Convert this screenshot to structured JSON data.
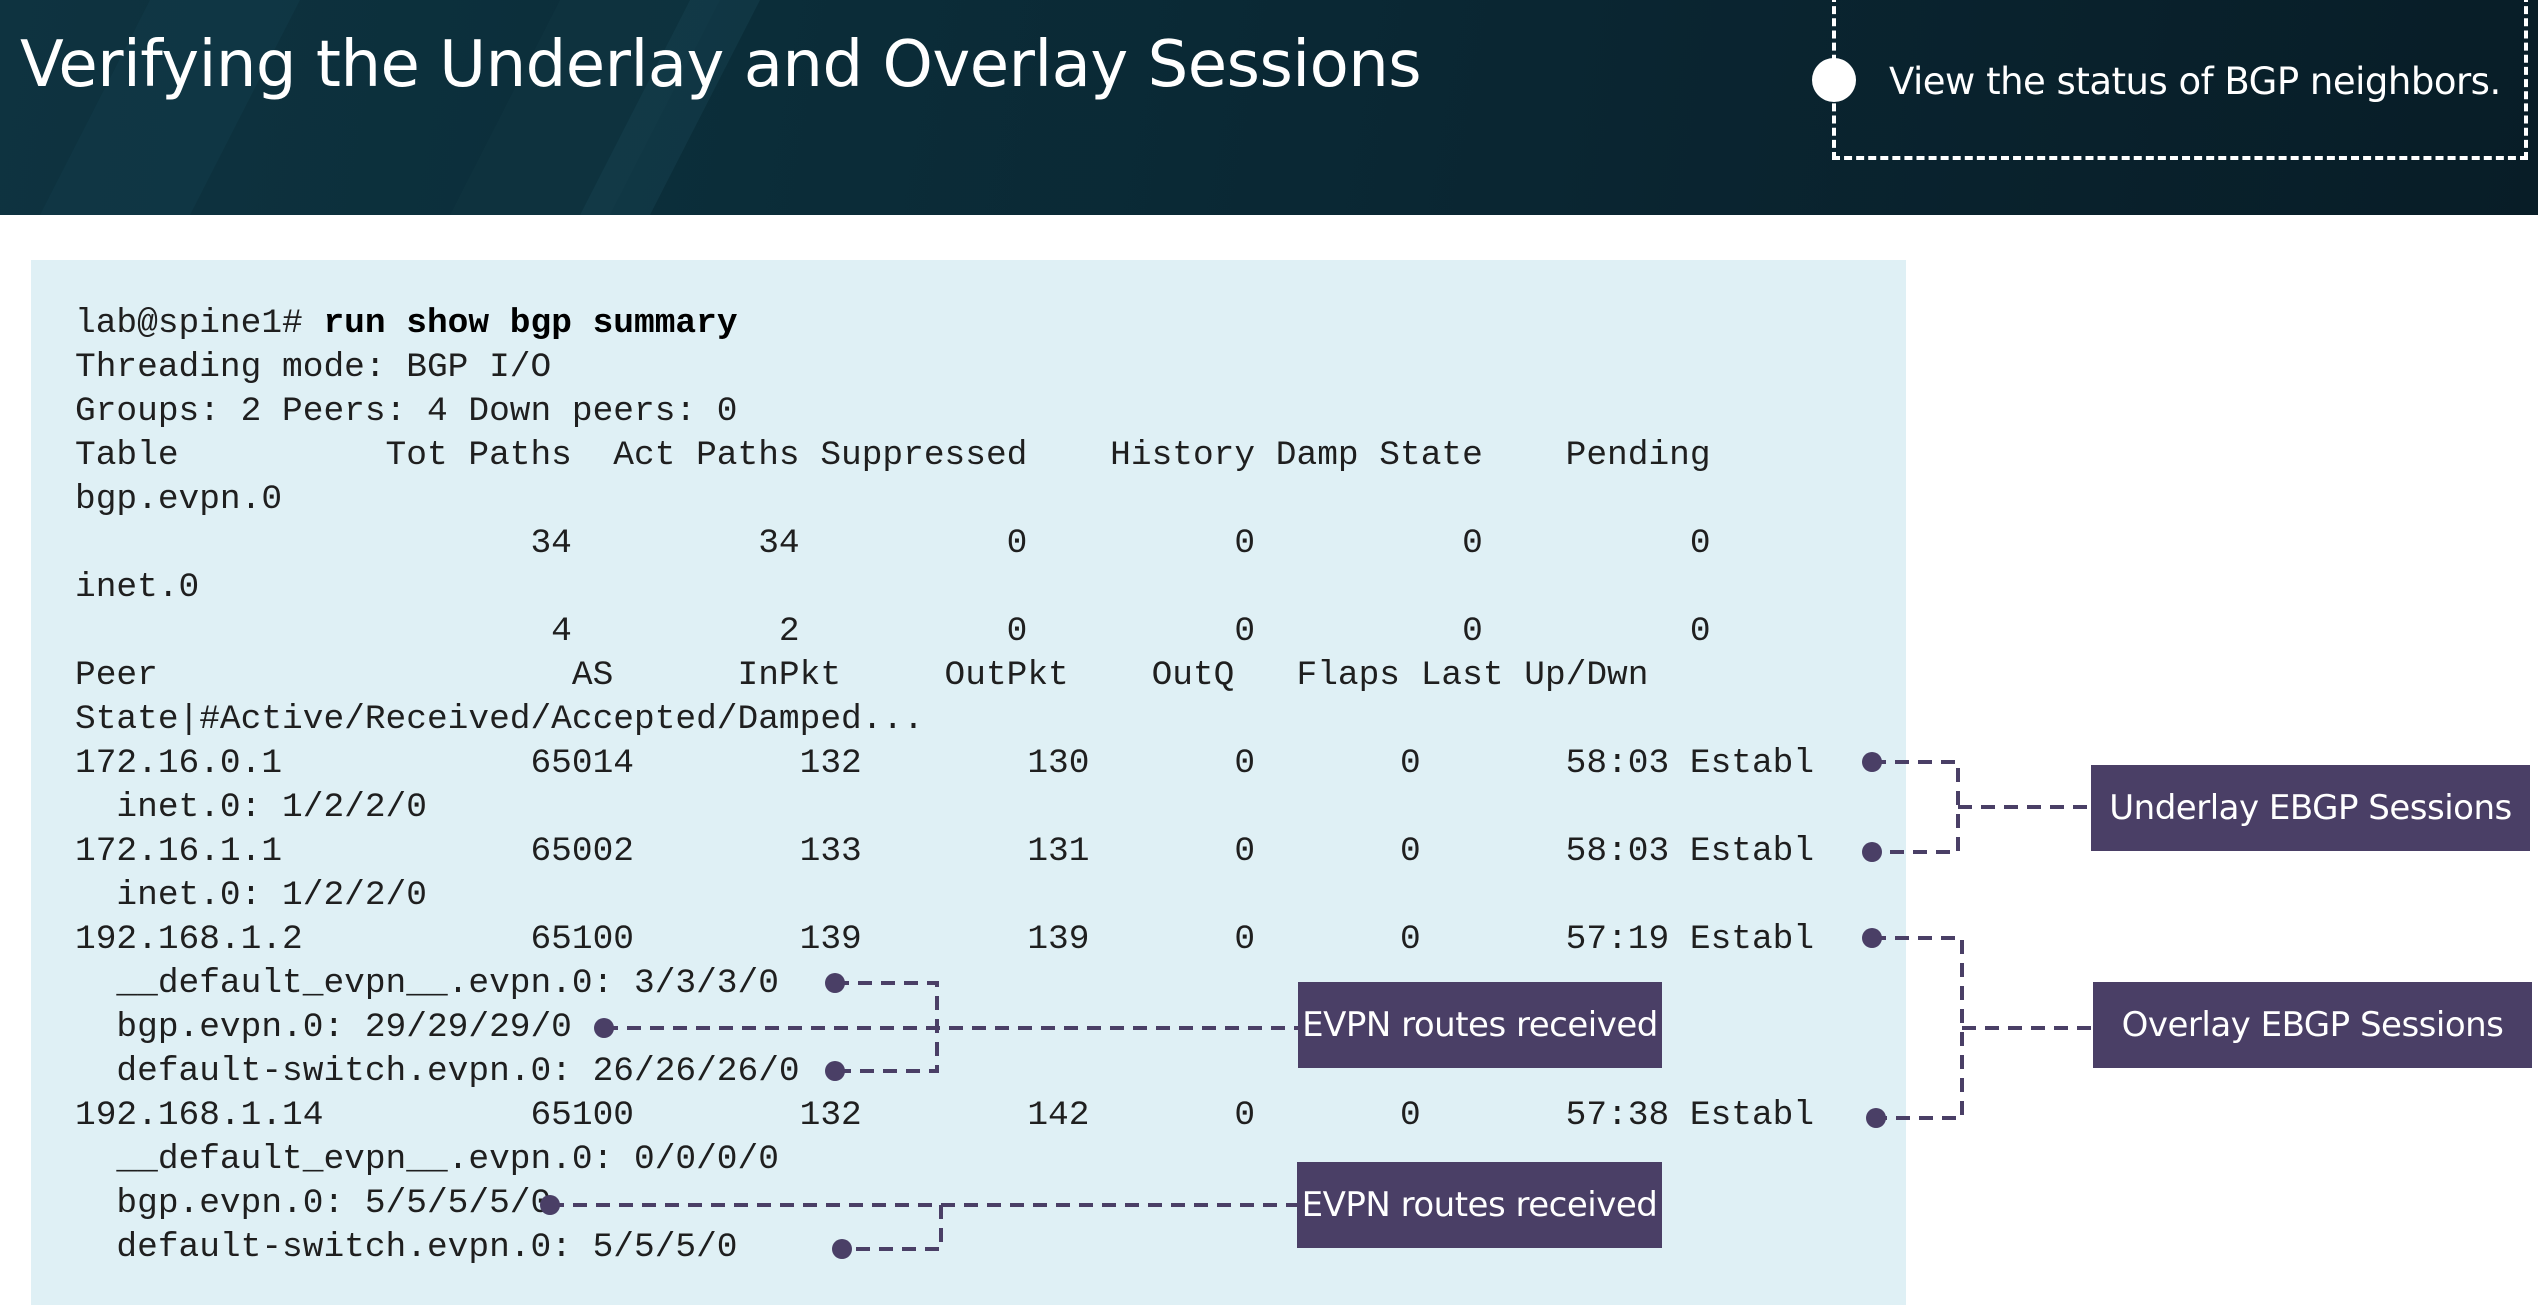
{
  "header": {
    "title": "Verifying the Underlay and Overlay Sessions",
    "callout": "View the status of BGP neighbors."
  },
  "terminal": {
    "prompt": "lab@spine1# ",
    "command": "run show bgp summary",
    "lines": [
      "Threading mode: BGP I/O",
      "Groups: 2 Peers: 4 Down peers: 0",
      "Table          Tot Paths  Act Paths Suppressed    History Damp State    Pending",
      "bgp.evpn.0",
      "                      34         34          0          0          0          0",
      "inet.0",
      "                       4          2          0          0          0          0",
      "Peer                    AS      InPkt     OutPkt    OutQ   Flaps Last Up/Dwn",
      "State|#Active/Received/Accepted/Damped...",
      "172.16.0.1            65014        132        130       0       0       58:03 Establ",
      "  inet.0: 1/2/2/0",
      "172.16.1.1            65002        133        131       0       0       58:03 Establ",
      "  inet.0: 1/2/2/0",
      "192.168.1.2           65100        139        139       0       0       57:19 Establ",
      "  __default_evpn__.evpn.0: 3/3/3/0",
      "  bgp.evpn.0: 29/29/29/0",
      "  default-switch.evpn.0: 26/26/26/0",
      "192.168.1.14          65100        132        142       0       0       57:38 Establ",
      "  __default_evpn__.evpn.0: 0/0/0/0",
      "  bgp.evpn.0: 5/5/5/5/0",
      "  default-switch.evpn.0: 5/5/5/0"
    ]
  },
  "annotations": {
    "underlay": "Underlay EBGP Sessions",
    "overlay": "Overlay EBGP Sessions",
    "evpn_1": "EVPN routes received",
    "evpn_2": "EVPN routes received"
  },
  "colors": {
    "header_bg": "#0b2d39",
    "terminal_bg": "#dff0f5",
    "label_bg": "#4a3f66",
    "connector": "#4a3f66"
  }
}
